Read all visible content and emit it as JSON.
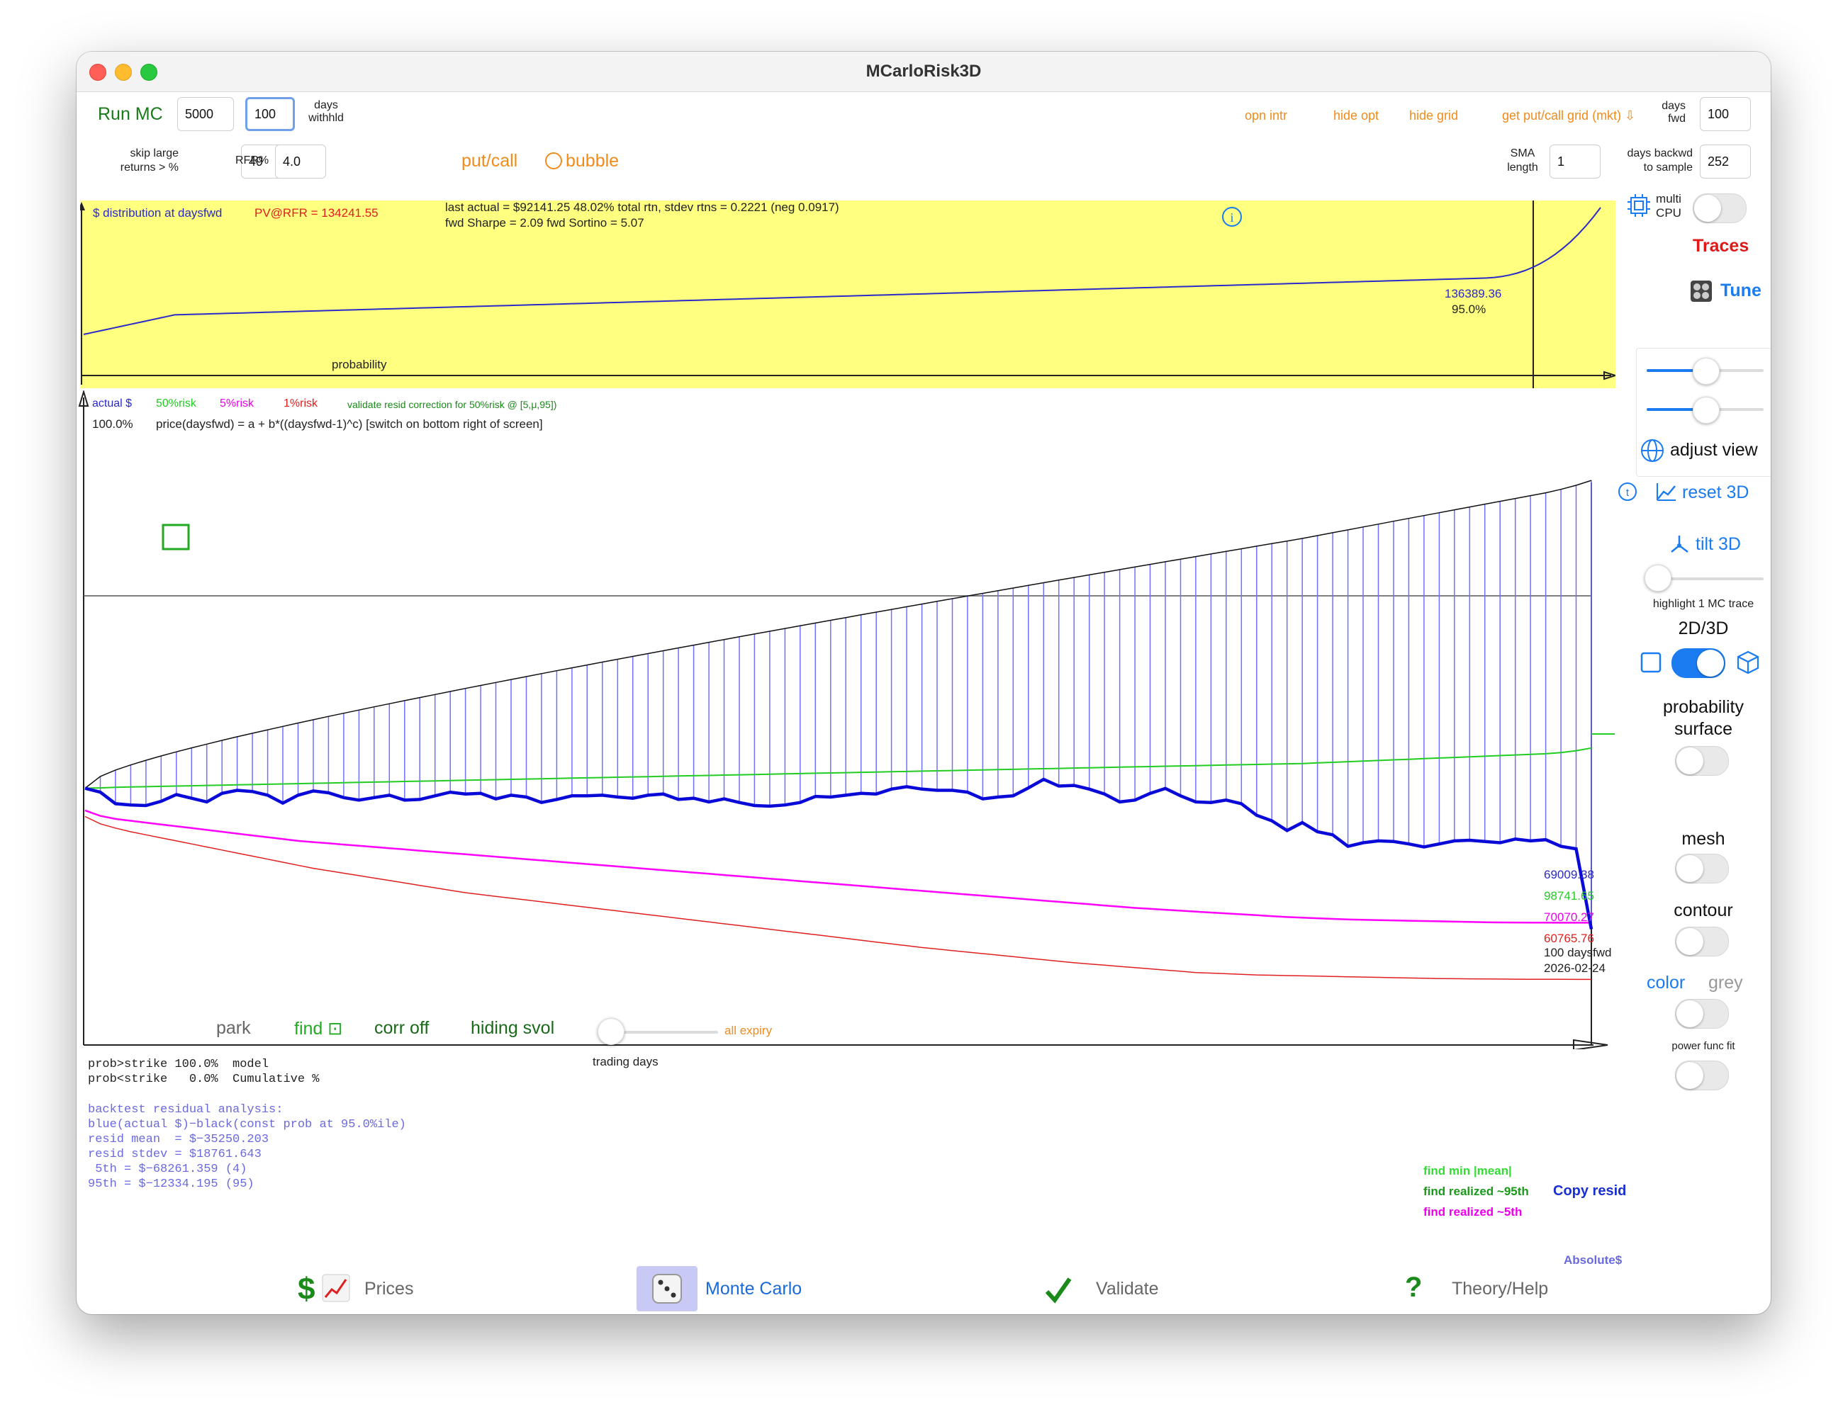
{
  "window": {
    "title": "MCarloRisk3D"
  },
  "toolbar": {
    "run_label": "Run MC",
    "runs_value": "5000",
    "days_withheld_value": "100",
    "days_withheld_label": "days\nwithhld",
    "opn_intr": "opn intr",
    "hide_opt": "hide opt",
    "hide_grid": "hide grid",
    "get_putcall_grid": "get put/call grid (mkt) ⇩",
    "days_fwd_label": "days\nfwd",
    "days_fwd_value": "100"
  },
  "row2": {
    "skip_label": "skip large\nreturns > %",
    "skip_value": "49",
    "rfr_label": "RFR%",
    "rfr_value": "4.0",
    "putcall": "put/call",
    "bubble": "bubble",
    "sma_label": "SMA\nlength",
    "sma_value": "1",
    "days_backwd_label": "days backwd\nto sample",
    "days_backwd_value": "252"
  },
  "distribution": {
    "title": "$ distribution at daysfwd",
    "pv_label": "PV@RFR = 134241.55",
    "stats_line1": "last actual = $92141.25  48.02% total rtn, stdev rtns = 0.2221 (neg 0.0917)",
    "stats_line2": "fwd Sharpe = 2.09 fwd Sortino = 5.07",
    "xlabel": "probability",
    "cursor_value": "136389.36",
    "cursor_pct": "95.0%",
    "info_icon": "info-circle-icon"
  },
  "main_chart": {
    "legend_actual": "actual $",
    "legend_50": "50%risk",
    "legend_5": "5%risk",
    "legend_1": "1%risk",
    "validate_note": "validate resid correction for 50%risk @ [5,μ,95])",
    "pct_label": "100.0%",
    "formula": "price(daysfwd) = a + b*((daysfwd-1)^c) [switch on bottom right of screen]",
    "xlabel": "trading days",
    "readout_actual": "69009.38",
    "readout_50": "98741.65",
    "readout_5": "70070.27",
    "readout_1": "60765.76",
    "readout_days": "100 daysfwd",
    "readout_date": "2026-02-24",
    "park": "park",
    "find": "find ⊡",
    "corr_off": "corr off",
    "hiding_svol": "hiding svol",
    "all_expiry": "all expiry",
    "colors": {
      "actual": "#0a0ad8",
      "risk50": "#22cc22",
      "risk5": "#ff00ff",
      "risk1": "#e02020",
      "upper": "#111111",
      "bars": "#7070ff"
    }
  },
  "chart_data": {
    "type": "line",
    "xlabel": "trading days",
    "ylabel": "",
    "x": [
      1,
      2,
      3,
      4,
      5,
      6,
      7,
      8,
      9,
      10,
      11,
      12,
      13,
      14,
      15,
      16,
      17,
      18,
      19,
      20,
      21,
      22,
      23,
      24,
      25,
      26,
      27,
      28,
      29,
      30,
      31,
      32,
      33,
      34,
      35,
      36,
      37,
      38,
      39,
      40,
      41,
      42,
      43,
      44,
      45,
      46,
      47,
      48,
      49,
      50,
      51,
      52,
      53,
      54,
      55,
      56,
      57,
      58,
      59,
      60,
      61,
      62,
      63,
      64,
      65,
      66,
      67,
      68,
      69,
      70,
      71,
      72,
      73,
      74,
      75,
      76,
      77,
      78,
      79,
      80,
      81,
      82,
      83,
      84,
      85,
      86,
      87,
      88,
      89,
      90,
      91,
      92,
      93,
      94,
      95,
      96,
      97,
      98,
      99,
      100
    ],
    "series": [
      {
        "name": "actual $",
        "values": [
          92141,
          91500,
          89600,
          89400,
          89300,
          90000,
          91100,
          90500,
          89900,
          91300,
          91800,
          91600,
          91000,
          89700,
          91000,
          91700,
          91400,
          90600,
          90200,
          90600,
          91000,
          90200,
          90300,
          90900,
          91500,
          91200,
          91300,
          90400,
          91000,
          90700,
          89800,
          90300,
          90900,
          90900,
          91000,
          90700,
          90500,
          91000,
          91200,
          90300,
          90500,
          89900,
          90400,
          89800,
          89300,
          89200,
          89400,
          89800,
          90800,
          90700,
          91000,
          91300,
          91200,
          92000,
          92400,
          92000,
          91800,
          91800,
          91500,
          90400,
          90700,
          90900,
          92200,
          93600,
          92500,
          92600,
          92000,
          91200,
          89900,
          90200,
          91300,
          92100,
          90900,
          89900,
          89800,
          90200,
          89600,
          87700,
          86800,
          85200,
          86500,
          85000,
          84500,
          82600,
          83200,
          83500,
          83400,
          83000,
          82500,
          83000,
          83500,
          83600,
          83400,
          83200,
          83800,
          83500,
          83700,
          82600,
          82200,
          69009
        ]
      },
      {
        "name": "50%risk",
        "values": [
          92141,
          92200,
          92300,
          92350,
          92400,
          92450,
          92500,
          92550,
          92600,
          92650,
          92700,
          92750,
          92800,
          92850,
          92900,
          92950,
          93000,
          93050,
          93100,
          93150,
          93200,
          93250,
          93300,
          93350,
          93400,
          93450,
          93500,
          93550,
          93600,
          93650,
          93700,
          93750,
          93800,
          93850,
          93900,
          93950,
          94000,
          94050,
          94100,
          94150,
          94200,
          94250,
          94300,
          94350,
          94400,
          94450,
          94500,
          94550,
          94600,
          94650,
          94700,
          94750,
          94800,
          94850,
          94900,
          94950,
          95000,
          95050,
          95100,
          95150,
          95200,
          95250,
          95300,
          95350,
          95400,
          95450,
          95500,
          95550,
          95600,
          95650,
          95700,
          95750,
          95800,
          95850,
          95900,
          95950,
          96000,
          96050,
          96100,
          96150,
          96200,
          96300,
          96400,
          96500,
          96600,
          96700,
          96800,
          96900,
          97000,
          97100,
          97200,
          97300,
          97400,
          97500,
          97600,
          97700,
          97800,
          98000,
          98300,
          98741
        ]
      },
      {
        "name": "5%risk",
        "values": [
          88500,
          87600,
          87100,
          86800,
          86500,
          86200,
          85900,
          85600,
          85300,
          85000,
          84700,
          84400,
          84100,
          83800,
          83500,
          83300,
          83100,
          82900,
          82700,
          82500,
          82300,
          82100,
          81900,
          81700,
          81500,
          81300,
          81100,
          80900,
          80700,
          80500,
          80300,
          80100,
          79900,
          79700,
          79500,
          79300,
          79100,
          78900,
          78700,
          78500,
          78300,
          78100,
          77900,
          77700,
          77500,
          77300,
          77100,
          76900,
          76700,
          76500,
          76300,
          76100,
          75900,
          75700,
          75500,
          75300,
          75100,
          74900,
          74700,
          74500,
          74300,
          74100,
          73900,
          73700,
          73500,
          73300,
          73100,
          72900,
          72700,
          72500,
          72350,
          72200,
          72050,
          71900,
          71750,
          71600,
          71450,
          71300,
          71150,
          71000,
          70900,
          70800,
          70700,
          70600,
          70550,
          70500,
          70450,
          70400,
          70350,
          70300,
          70250,
          70200,
          70150,
          70120,
          70100,
          70090,
          70080,
          70075,
          70072,
          70070
        ]
      },
      {
        "name": "1%risk",
        "values": [
          87500,
          86300,
          85600,
          85000,
          84500,
          84000,
          83500,
          83000,
          82500,
          82000,
          81500,
          81000,
          80500,
          80000,
          79500,
          79000,
          78600,
          78200,
          77800,
          77400,
          77000,
          76600,
          76200,
          75800,
          75400,
          75000,
          74700,
          74400,
          74100,
          73800,
          73500,
          73200,
          72900,
          72600,
          72300,
          72000,
          71700,
          71400,
          71100,
          70800,
          70500,
          70200,
          69900,
          69600,
          69300,
          69000,
          68700,
          68400,
          68100,
          67800,
          67500,
          67200,
          66900,
          66600,
          66300,
          66000,
          65750,
          65500,
          65250,
          65000,
          64750,
          64500,
          64250,
          64000,
          63750,
          63500,
          63300,
          63100,
          62900,
          62700,
          62500,
          62300,
          62100,
          61900,
          61800,
          61700,
          61600,
          61500,
          61450,
          61400,
          61350,
          61300,
          61250,
          61200,
          61150,
          61100,
          61050,
          61000,
          60950,
          60900,
          60880,
          60860,
          60840,
          60820,
          60800,
          60790,
          60780,
          60775,
          60770,
          60765
        ]
      }
    ]
  },
  "analysis": {
    "prob_line1": "prob>strike 100.0%  model",
    "prob_line2": "prob<strike   0.0%  Cumulative %",
    "bt1": "backtest residual analysis:",
    "bt2": "blue(actual $)−black(const prob at 95.0%ile)",
    "bt3": "resid mean  = $−35250.203",
    "bt4": "resid stdev = $18761.643",
    "bt5": " 5th = $−68261.359 (4)",
    "bt6": "95th = $−12334.195 (95)",
    "find_min_mean": "find min |mean|",
    "find_realized_95": "find realized ~95th",
    "copy_resid": "Copy resid",
    "find_realized_5": "find realized ~5th",
    "absolute": "Absolute$"
  },
  "sidebar": {
    "multi_cpu": "multi\nCPU",
    "traces": "Traces",
    "tune": "Tune",
    "adjust_view": "adjust view",
    "reset_3d": "reset 3D",
    "tilt_3d": "tilt 3D",
    "highlight_trace": "highlight 1 MC trace",
    "mode_2d3d": "2D/3D",
    "prob_surface": "probability\nsurface",
    "mesh": "mesh",
    "contour": "contour",
    "color": "color",
    "grey": "grey",
    "power_func_fit": "power func fit"
  },
  "bottom_tabs": [
    {
      "label": "Prices"
    },
    {
      "label": "Monte Carlo"
    },
    {
      "label": "Validate"
    },
    {
      "label": "Theory/Help"
    }
  ]
}
